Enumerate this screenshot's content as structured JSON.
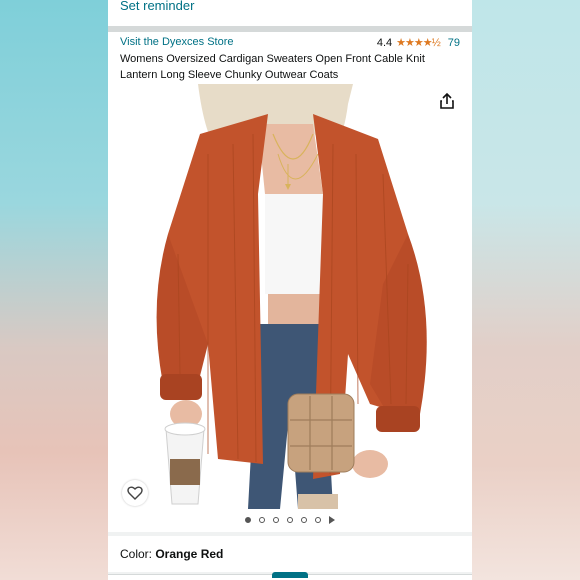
{
  "reminder": {
    "label": "Set reminder"
  },
  "product": {
    "store_link": "Visit the Dyexces Store",
    "rating_value": "4.4",
    "stars": "★★★★½",
    "review_count": "79",
    "title": "Womens Oversized Cardigan Sweaters Open Front Cable Knit Lantern Long Sleeve Chunky Outwear Coats"
  },
  "gallery": {
    "image_count": 6,
    "active_index": 0,
    "share_icon": "share-icon",
    "favorite_icon": "heart-icon",
    "video_icon": "play-icon"
  },
  "color": {
    "label": "Color: ",
    "value": "Orange Red"
  },
  "colors": {
    "link": "#007185",
    "star": "#de7921",
    "sweater": "#c2532c"
  }
}
